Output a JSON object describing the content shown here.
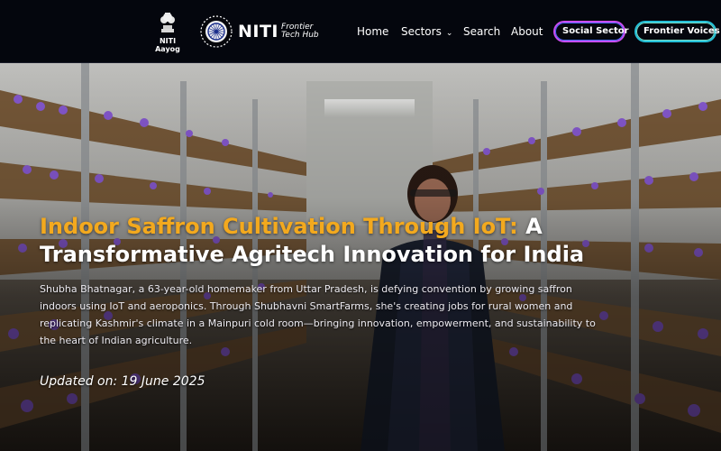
{
  "header": {
    "org_name": "NITI Aayog",
    "brand": {
      "main": "NITI",
      "sub_line1": "Frontier",
      "sub_line2": "Tech Hub"
    },
    "nav": [
      {
        "label": "Home"
      },
      {
        "label": "Sectors",
        "has_dropdown": true
      },
      {
        "label": "Search"
      },
      {
        "label": "About"
      }
    ],
    "buttons": {
      "social": "Social Sector",
      "voices": "Frontier Voices"
    }
  },
  "hero": {
    "title_accent": "Indoor Saffron Cultivation Through IoT:",
    "title_rest": " A Transformative Agritech Innovation for India",
    "description": "Shubha Bhatnagar, a 63-year-old homemaker from Uttar Pradesh, is defying convention by growing saffron indoors using IoT and aeroponics. Through Shubhavni SmartFarms, she's creating jobs for rural women and replicating Kashmir's climate in a Mainpuri cold room—bringing innovation, empowerment, and sustainability to the heart of Indian agriculture.",
    "updated": "Updated on: 19 June 2025",
    "image": "saffron-indoor-farm-photo"
  },
  "colors": {
    "header_bg": "#04060d",
    "title_accent": "#f3a91e",
    "social_pill_border": "#c94df0",
    "voices_pill_border": "#24c0d8",
    "saffron_flower": "#8a5bd6"
  },
  "icons": [
    "national-emblem-icon",
    "ashoka-chakra-icon",
    "chevron-down-icon"
  ]
}
